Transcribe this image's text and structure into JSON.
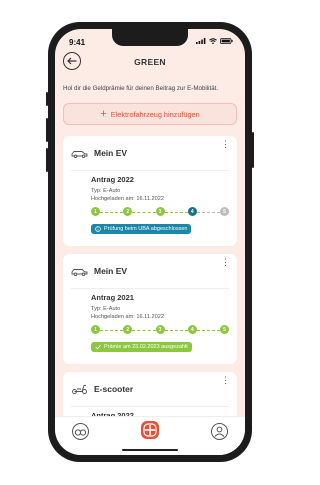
{
  "status": {
    "time": "9:41"
  },
  "header": {
    "title": "GREEN"
  },
  "intro_text": "Hol dir die Geldprämie für deinen Beitrag zur E-Mobilität.",
  "add_button": {
    "label": "Elektrofahrzeug hinzufügen"
  },
  "cards": [
    {
      "vehicle": "Mein EV",
      "icon": "car-icon",
      "application": "Antrag 2022",
      "type": "Typ: E-Auto",
      "uploaded": "Hochgeladen am: 16.11.2022",
      "steps": [
        "1",
        "2",
        "3",
        "4",
        "5"
      ],
      "completed_steps": 4,
      "badge": "Prüfung beim UBA abgeschlossen",
      "badge_color": "#1a86a8"
    },
    {
      "vehicle": "Mein EV",
      "icon": "car-icon",
      "application": "Antrag 2021",
      "type": "Typ: E-Auto",
      "uploaded": "Hochgeladen am: 16.11.2022",
      "steps": [
        "1",
        "2",
        "3",
        "4",
        "5"
      ],
      "completed_steps": 5,
      "badge": "Prämie am 23.02.2023 ausgezahlt",
      "badge_color": "#8dc63f"
    },
    {
      "vehicle": "E-scooter",
      "icon": "scooter-icon",
      "application": "Antrag 2022"
    }
  ],
  "colors": {
    "accent": "#e5523a",
    "done": "#8dc63f",
    "current": "#1a6e8a",
    "pending": "#bdbdbd"
  },
  "tabbar": [
    "bike-icon",
    "app-logo-icon",
    "profile-icon"
  ]
}
